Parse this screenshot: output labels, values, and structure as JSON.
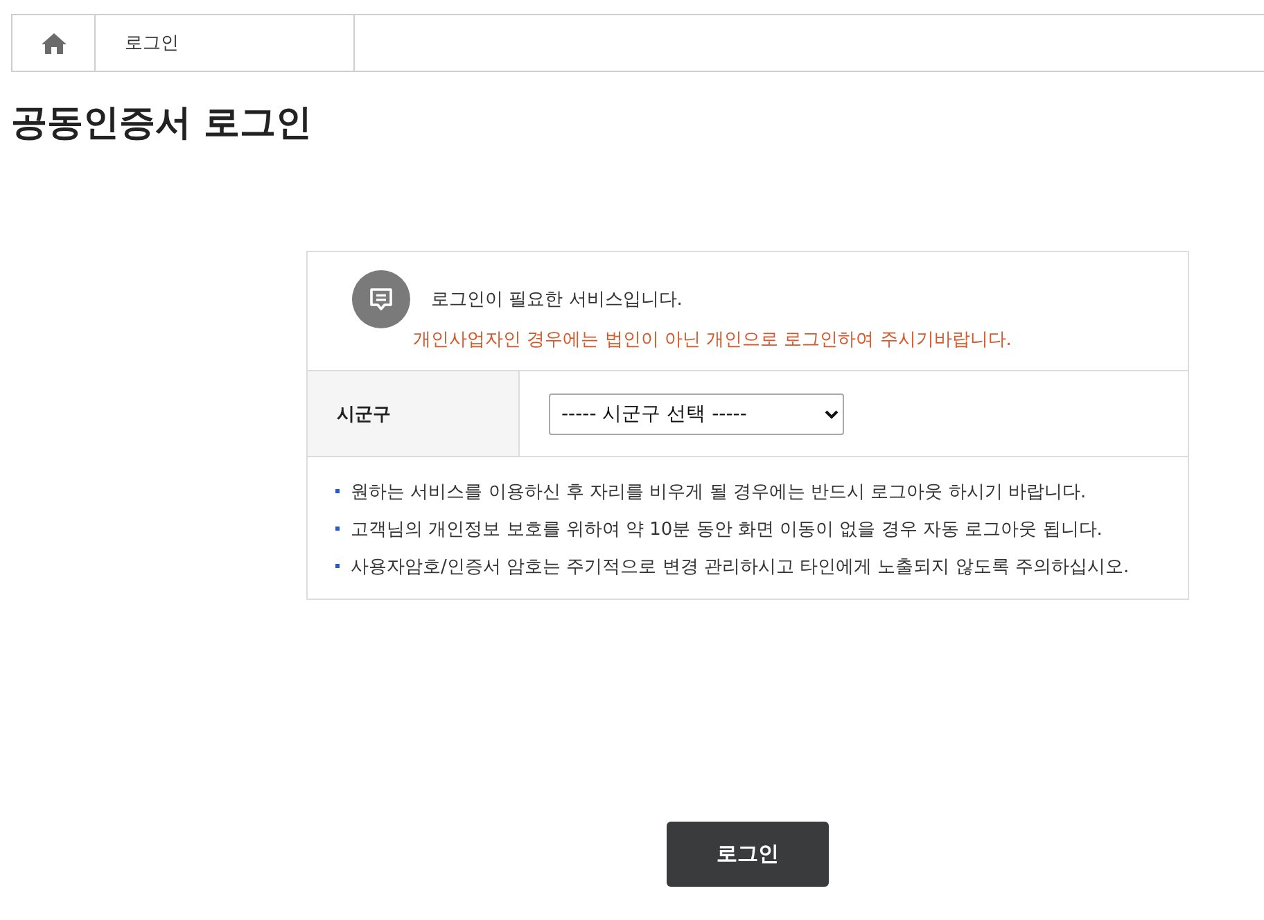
{
  "breadcrumb": {
    "items": [
      "로그인"
    ]
  },
  "title": "공동인증서 로그인",
  "notice": {
    "message": "로그인이 필요한 서비스입니다.",
    "warning": "개인사업자인 경우에는 법인이 아닌 개인으로 로그인하여 주시기바랍니다."
  },
  "district": {
    "label": "시군구",
    "value": "----- 시군구 선택 -----"
  },
  "guidelines": [
    "원하는 서비스를 이용하신 후 자리를 비우게 될 경우에는 반드시 로그아웃 하시기 바랍니다.",
    "고객님의 개인정보 보호를 위하여 약 10분 동안 화면 이동이 없을 경우 자동 로그아웃 됩니다.",
    "사용자암호/인증서 암호는 주기적으로 변경 관리하시고 타인에게 노출되지 않도록 주의하십시오."
  ],
  "buttons": [
    "로그인"
  ]
}
